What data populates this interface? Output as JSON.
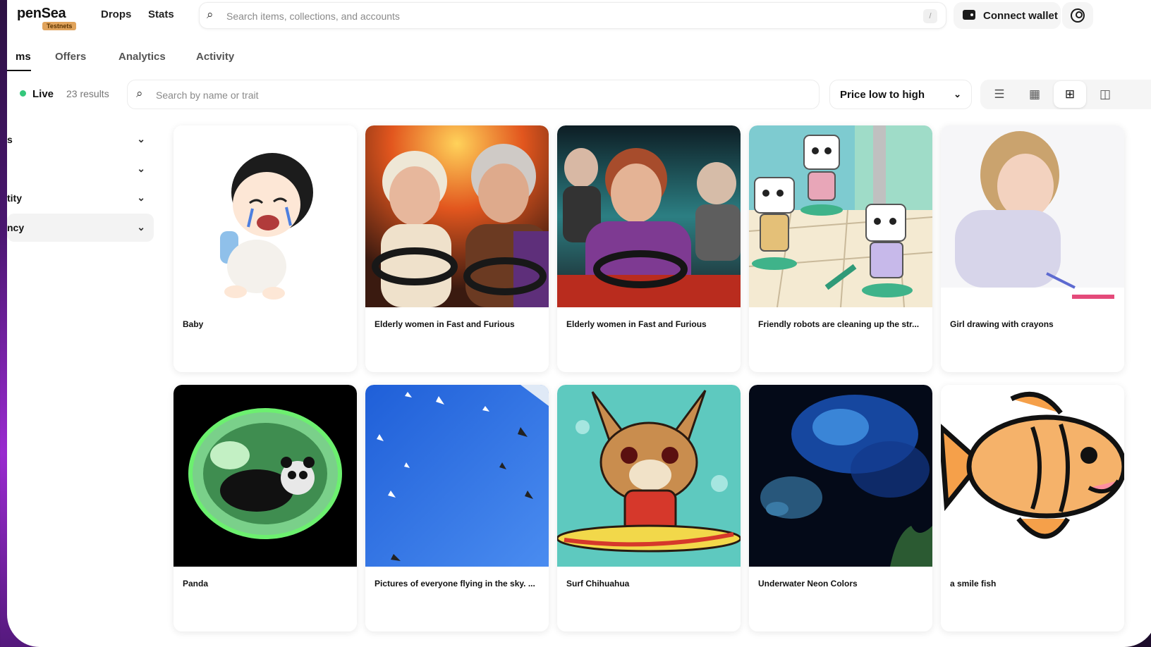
{
  "header": {
    "logo": "penSea",
    "badge": "Testnets",
    "nav": [
      "Drops",
      "Stats"
    ],
    "search_placeholder": "Search items, collections, and accounts",
    "search_shortcut": "/",
    "connect_label": "Connect wallet"
  },
  "tabs": [
    "ms",
    "Offers",
    "Analytics",
    "Activity"
  ],
  "filterbar": {
    "live_label": "Live",
    "results": "23 results",
    "search_placeholder": "Search by name or trait",
    "sort_label": "Price low to high"
  },
  "sidebar": {
    "filters": [
      "s",
      "",
      "tity",
      "ncy"
    ]
  },
  "items": [
    {
      "name": "Baby"
    },
    {
      "name": "Elderly women in Fast and Furious"
    },
    {
      "name": "Elderly women in Fast and Furious"
    },
    {
      "name": "Friendly robots are cleaning up the str..."
    },
    {
      "name": "Girl drawing with crayons"
    },
    {
      "name": "Panda"
    },
    {
      "name": "Pictures of everyone flying in the sky. ..."
    },
    {
      "name": "Surf Chihuahua"
    },
    {
      "name": "Underwater Neon Colors"
    },
    {
      "name": "a smile fish"
    }
  ],
  "colors": {
    "live": "#34c77b",
    "badge": "#e0a35b",
    "text": "#121212"
  }
}
